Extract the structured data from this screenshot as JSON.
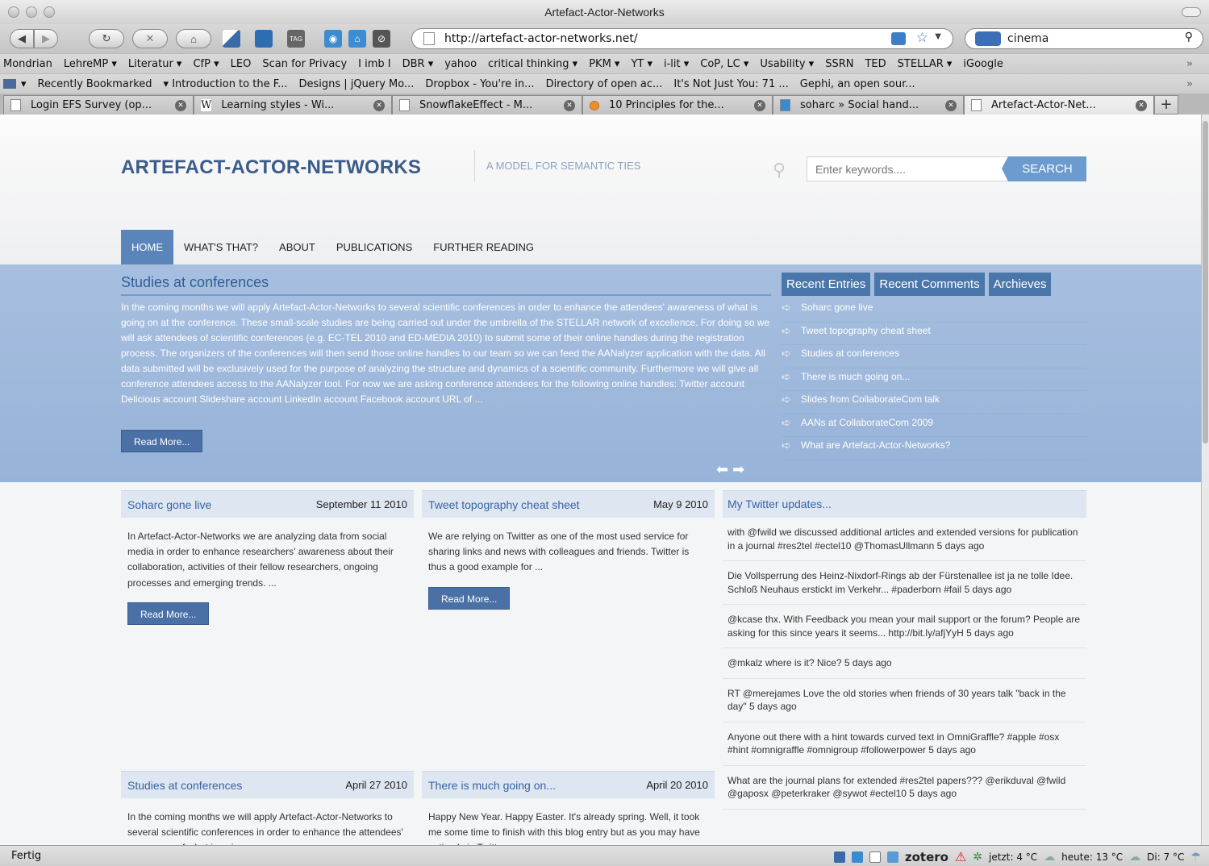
{
  "window": {
    "title": "Artefact-Actor-Networks"
  },
  "toolbar": {
    "url": "http://artefact-actor-networks.net/",
    "search_value": "cinema",
    "tag_icon_label": "TAG"
  },
  "bookmarks_bar": [
    "Mondrian",
    "LehreMP ▾",
    "Literatur ▾",
    "CfP ▾",
    "LEO",
    "Scan for Privacy",
    "I imb I",
    "DBR ▾",
    "yahoo",
    "critical thinking ▾",
    "PKM ▾",
    "YT ▾",
    "i-lit ▾",
    "CoP, LC ▾",
    "Usability ▾",
    "SSRN",
    "TED",
    "STELLAR ▾",
    "iGoogle"
  ],
  "bookmarks_bar2": [
    "Recently Bookmarked",
    "▾ Introduction to the F...",
    "Designs | jQuery Mo...",
    "Dropbox - You're in...",
    "Directory of open ac...",
    "It's Not Just You: 71 ...",
    "Gephi, an open sour..."
  ],
  "tabs": [
    {
      "label": "Login EFS Survey (op..."
    },
    {
      "label": "Learning styles - Wi..."
    },
    {
      "label": "SnowflakeEffect - M..."
    },
    {
      "label": "10 Principles for the..."
    },
    {
      "label": "soharc » Social hand..."
    },
    {
      "label": "Artefact-Actor-Net..."
    }
  ],
  "site": {
    "logo": "ARTEFACT-ACTOR-NETWORKS",
    "tagline": "A MODEL FOR SEMANTIC TIES",
    "search_placeholder": "Enter keywords....",
    "search_button": "SEARCH",
    "nav": [
      "HOME",
      "WHAT'S THAT?",
      "ABOUT",
      "PUBLICATIONS",
      "FURTHER READING"
    ]
  },
  "featured": {
    "title": "Studies at conferences",
    "text": "In the coming months we will apply Artefact-Actor-Networks to several scientific conferences in order to enhance the attendees' awareness of what is going on at the conference. These small-scale studies are being carried out under the umbrella of the STELLAR network of excellence. For doing so we will ask attendees of scientific conferences (e.g. EC-TEL 2010 and ED-MEDIA 2010) to submit some of their online handles during the registration process. The organizers of the conferences will then send those online handles to our team so we can feed the AANalyzer application with the data. All data submitted will be exclusively used for the purpose of analyzing the structure and dynamics of a scientific community. Furthermore we will give all conference attendees access to the AANalyzer tool. For now we are asking conference attendees for the following online handles: Twitter account Delicious account Slideshare account LinkedIn account Facebook account URL of ...",
    "read_more": "Read More...",
    "arrows": "⬅ ➡"
  },
  "sidebar": {
    "tabs": [
      "Recent Entries",
      "Recent Comments",
      "Archieves"
    ],
    "entries": [
      "Soharc gone live",
      "Tweet topography cheat sheet",
      "Studies at conferences",
      "There is much going on...",
      "Slides from CollaborateCom talk",
      "AANs at CollaborateCom 2009",
      "What are Artefact-Actor-Networks?"
    ]
  },
  "posts": [
    {
      "title": "Soharc gone live",
      "date": "September 11 2010",
      "excerpt": "In Artefact-Actor-Networks we are analyzing data from social media in order to enhance researchers' awareness about their collaboration, activities of their fellow researchers, ongoing processes and emerging trends. ...",
      "read_more": "Read More..."
    },
    {
      "title": "Tweet topography cheat sheet",
      "date": "May 9 2010",
      "excerpt": "We are relying on Twitter as one of the most used service for sharing links and news with colleagues and friends. Twitter is thus a good example for ...",
      "read_more": "Read More..."
    },
    {
      "title": "Studies at conferences",
      "date": "April 27 2010",
      "excerpt": "In the coming months we will apply Artefact-Actor-Networks to several scientific conferences in order to enhance the attendees' awareness of what is going on"
    },
    {
      "title": "There is much going on...",
      "date": "April 20 2010",
      "excerpt": "Happy New Year. Happy Easter. It's already spring. Well, it took me some time to finish with this blog entry but as you may have noticed via Twitter ..."
    }
  ],
  "twitter": {
    "title": "My Twitter updates...",
    "tweets": [
      "with @fwild we discussed additional articles and extended versions for publication in a journal #res2tel #ectel10 @ThomasUllmann 5 days ago",
      "Die Vollsperrung des Heinz-Nixdorf-Rings ab der Fürstenallee ist ja ne tolle Idee. Schloß Neuhaus erstickt im Verkehr... #paderborn #fail 5 days ago",
      "@kcase thx. With Feedback you mean your mail support or the forum? People are asking for this since years it seems... http://bit.ly/afjYyH 5 days ago",
      "@mkalz where is it? Nice? 5 days ago",
      "RT @merejames Love the old stories when friends of 30 years talk \"back in the day\" 5 days ago",
      "Anyone out there with a hint towards curved text in OmniGraffle? #apple #osx #hint #omnigraffle #omnigroup #followerpower 5 days ago",
      "What are the journal plans for extended #res2tel papers??? @erikduval @fwild @gaposx @peterkraker @sywot #ectel10 5 days ago"
    ]
  },
  "statusbar": {
    "text": "Fertig",
    "zotero": "zotero",
    "weather_now": "jetzt: 4 °C",
    "weather_today": "heute: 13 °C",
    "weather_tue": "Di: 7 °C"
  },
  "colors": {
    "accent": "#5a85bb",
    "featured_bg": "#a7bfdf",
    "logo": "#3b5c8a",
    "link": "#3664a3"
  }
}
